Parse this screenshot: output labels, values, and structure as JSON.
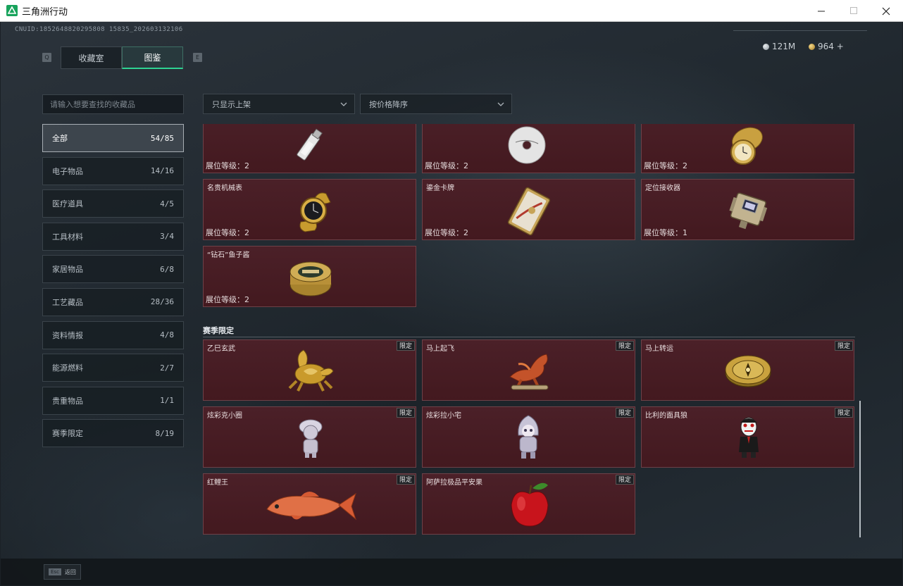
{
  "window": {
    "title": "三角洲行动"
  },
  "header": {
    "uid": "CNUID:1852648820295808 15835_202603132106",
    "currency": [
      {
        "icon": "silver-coin-icon",
        "value": "121M",
        "color": "#b9c0c6"
      },
      {
        "icon": "gold-coin-icon",
        "value": "964 +",
        "color": "#c9a24a"
      }
    ],
    "key_left": "Q",
    "key_right": "E",
    "tabs": [
      {
        "label": "收藏室",
        "active": false
      },
      {
        "label": "图鉴",
        "active": true
      }
    ]
  },
  "search": {
    "placeholder": "请输入想要查找的收藏品"
  },
  "categories": [
    {
      "label": "全部",
      "count": "54/85",
      "active": true
    },
    {
      "label": "电子物品",
      "count": "14/16"
    },
    {
      "label": "医疗道具",
      "count": "4/5"
    },
    {
      "label": "工具材料",
      "count": "3/4"
    },
    {
      "label": "家居物品",
      "count": "6/8"
    },
    {
      "label": "工艺藏品",
      "count": "28/36"
    },
    {
      "label": "资料情报",
      "count": "4/8"
    },
    {
      "label": "能源燃料",
      "count": "2/7"
    },
    {
      "label": "贵重物品",
      "count": "1/1"
    },
    {
      "label": "赛季限定",
      "count": "8/19"
    }
  ],
  "filters": {
    "shelf": "只显示上架",
    "sort": "按价格降序"
  },
  "level_prefix": "展位等级：",
  "items": [
    {
      "name": "",
      "level": "2",
      "icon": "usb-drive-icon"
    },
    {
      "name": "",
      "level": "2",
      "icon": "cd-disc-icon"
    },
    {
      "name": "",
      "level": "2",
      "icon": "pocket-watch-icon"
    },
    {
      "name": "名贵机械表",
      "level": "2",
      "icon": "wristwatch-icon"
    },
    {
      "name": "鎏金卡牌",
      "level": "2",
      "icon": "gold-card-icon"
    },
    {
      "name": "定位接收器",
      "level": "1",
      "icon": "gps-receiver-icon"
    },
    {
      "name": "“钻石”鱼子酱",
      "level": "2",
      "icon": "caviar-tin-icon"
    }
  ],
  "season": {
    "title": "赛季限定",
    "badge": "限定",
    "items": [
      {
        "name": "乙巳玄武",
        "icon": "gold-turtle-icon"
      },
      {
        "name": "马上起飞",
        "icon": "flying-horse-icon"
      },
      {
        "name": "马上转运",
        "icon": "gold-compass-icon"
      },
      {
        "name": "炫彩克小圈",
        "icon": "figurine-girl-icon"
      },
      {
        "name": "炫彩拉小宅",
        "icon": "figurine-hooded-icon"
      },
      {
        "name": "比利的面具狼",
        "icon": "puppet-mask-icon"
      },
      {
        "name": "红鲤王",
        "icon": "red-carp-icon"
      },
      {
        "name": "阿萨拉极品平安果",
        "icon": "red-apple-icon"
      }
    ]
  },
  "footer": {
    "esc_key": "Esc",
    "esc_label": "返回"
  }
}
